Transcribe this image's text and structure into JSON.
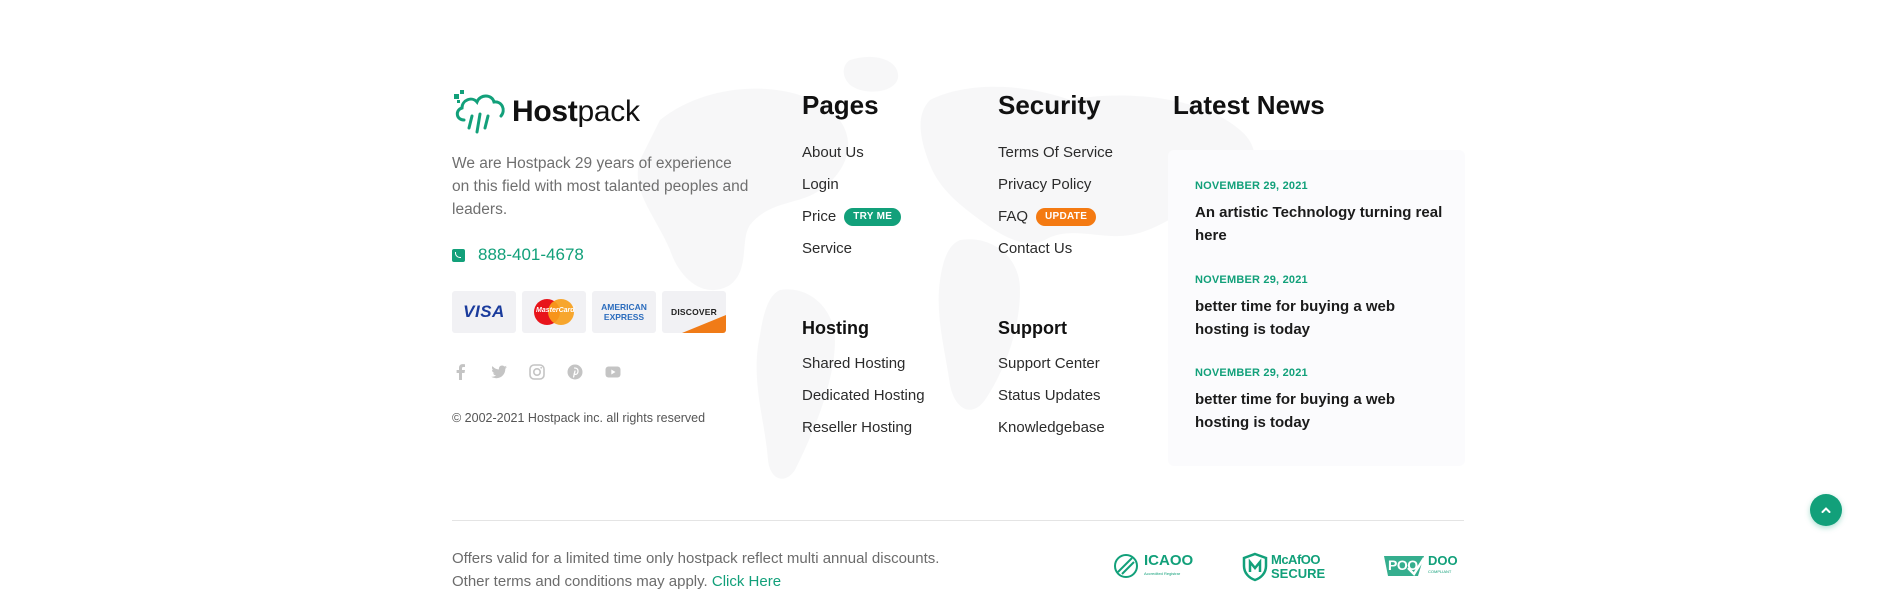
{
  "brand": {
    "name_bold": "Host",
    "name_regular": "pack",
    "about": "We are Hostpack 29 years of experience on this field with most talanted peoples and leaders.",
    "phone": "888-401-4678",
    "cards": [
      "VISA",
      "MasterCard",
      "AMERICAN EXPRESS",
      "DISCOVER"
    ],
    "social": [
      "facebook-icon",
      "twitter-icon",
      "instagram-icon",
      "pinterest-icon",
      "youtube-icon"
    ],
    "copyright": "© 2002-2021 Hostpack inc. all rights reserved"
  },
  "pages": {
    "heading": "Pages",
    "links": [
      "About Us",
      "Login",
      "Price",
      "Service"
    ],
    "price_badge": "TRY ME"
  },
  "security": {
    "heading": "Security",
    "links": [
      "Terms Of Service",
      "Privacy Policy",
      "FAQ",
      "Contact Us"
    ],
    "faq_badge": "UPDATE"
  },
  "hosting": {
    "heading": "Hosting",
    "links": [
      "Shared Hosting",
      "Dedicated Hosting",
      "Reseller Hosting"
    ]
  },
  "support": {
    "heading": "Support",
    "links": [
      "Support Center",
      "Status Updates",
      "Knowledgebase"
    ]
  },
  "news": {
    "heading": "Latest News",
    "items": [
      {
        "date": "NOVEMBER 29, 2021",
        "title": "An artistic Technology turning real here"
      },
      {
        "date": "NOVEMBER 29, 2021",
        "title": "better time for buying a web hosting is today"
      },
      {
        "date": "NOVEMBER 29, 2021",
        "title": "better time for buying a web hosting is today"
      }
    ]
  },
  "bottom": {
    "offer_line1": "Offers valid for a limited time only hostpack reflect multi annual discounts.",
    "offer_line2": "Other terms and conditions may apply.",
    "click_here": "Click Here",
    "trust_icaoo": "ICAOO",
    "trust_icaoo_sub": "Accredited Registrar",
    "trust_mcafee_line1": "McAfOO",
    "trust_mcafee_line2": "SECURE",
    "trust_poo": "POO",
    "trust_doo": "DOO",
    "trust_doo_sub": "COMPLIANT"
  },
  "colors": {
    "accent": "#12a07a",
    "orange": "#f47a12"
  }
}
